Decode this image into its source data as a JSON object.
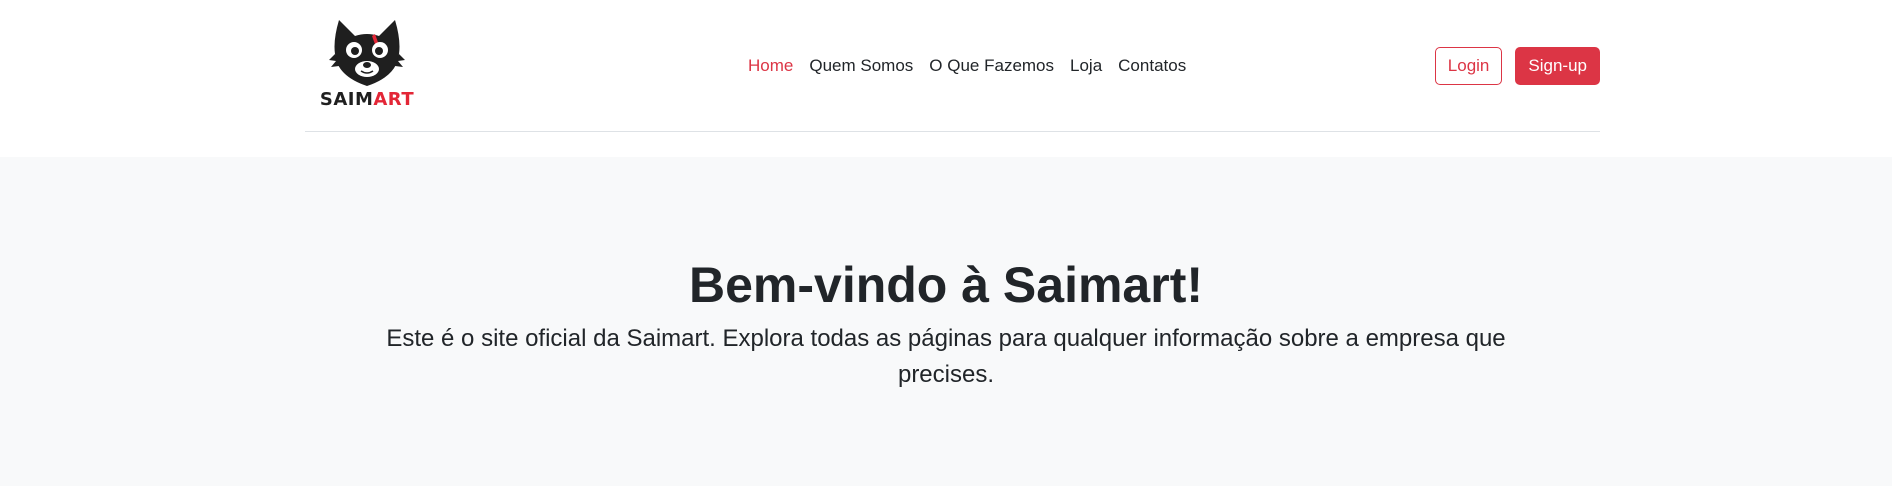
{
  "header": {
    "logo": {
      "icon": "cat-face-icon",
      "text_part1": "SAIM",
      "text_part2": "ART",
      "accent_color": "#e32636"
    },
    "nav": [
      {
        "label": "Home",
        "active": true
      },
      {
        "label": "Quem Somos",
        "active": false
      },
      {
        "label": "O Que Fazemos",
        "active": false
      },
      {
        "label": "Loja",
        "active": false
      },
      {
        "label": "Contatos",
        "active": false
      }
    ],
    "login_label": "Login",
    "signup_label": "Sign-up"
  },
  "hero": {
    "title": "Bem-vindo à Saimart!",
    "subtitle": "Este é o site oficial da Saimart. Explora todas as páginas para qualquer informação sobre a empresa que precises."
  },
  "colors": {
    "primary": "#dc3545",
    "background": "#f8f9fa",
    "text": "#212529"
  }
}
